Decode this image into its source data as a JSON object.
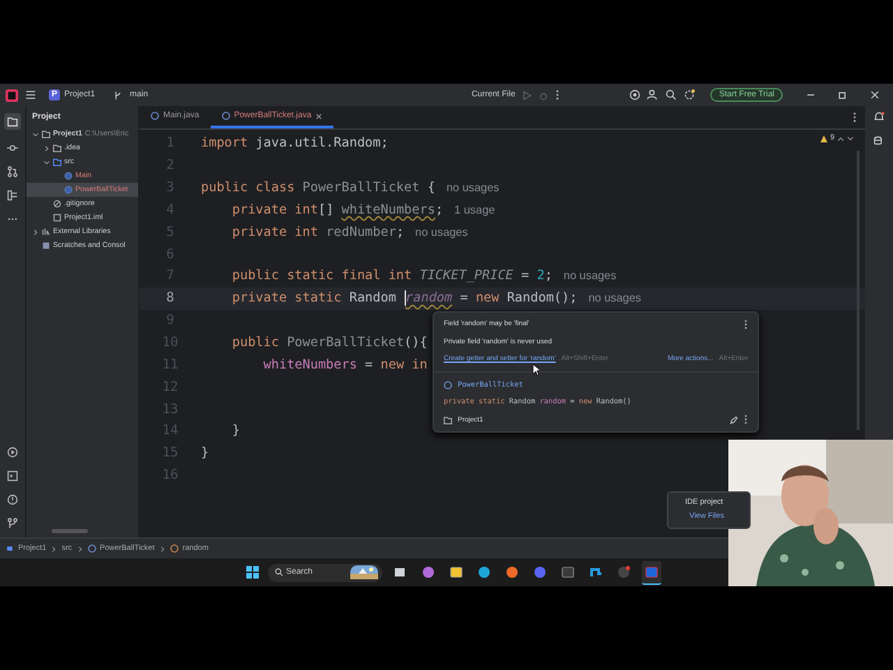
{
  "titlebar": {
    "project_badge": "P",
    "project": "Project1",
    "branch": "main",
    "run_config": "Current File",
    "trial_button": "Start Free Trial"
  },
  "project_panel": {
    "title": "Project",
    "tree": [
      {
        "kind": "module",
        "label": "Project1",
        "path": "C:\\Users\\Eric",
        "expanded": true,
        "selected": false,
        "children": [
          {
            "kind": "folder",
            "label": ".idea",
            "expanded": false,
            "selected": false
          },
          {
            "kind": "folder",
            "label": "src",
            "expanded": true,
            "selected": false,
            "children": [
              {
                "kind": "class",
                "label": "Main",
                "selected": false
              },
              {
                "kind": "class",
                "label": "PowerBallTicket",
                "selected": true
              }
            ]
          },
          {
            "kind": "ignore",
            "label": ".gitignore",
            "selected": false
          },
          {
            "kind": "file",
            "label": "Project1.iml",
            "selected": false
          }
        ]
      },
      {
        "kind": "library",
        "label": "External Libraries",
        "expanded": false,
        "selected": false
      },
      {
        "kind": "scratch",
        "label": "Scratches and Consol",
        "selected": false
      }
    ]
  },
  "tabs": [
    {
      "label": "Main.java",
      "selected": false
    },
    {
      "label": "PowerBallTicket.java",
      "selected": true
    }
  ],
  "problems_count": "9",
  "code_lines": [
    {
      "number": "1",
      "current": false,
      "tokens": [
        {
          "kind": "keyword",
          "text": "import "
        },
        {
          "kind": "plain",
          "text": "java.util.Random;"
        }
      ]
    },
    {
      "number": "2",
      "current": false
    },
    {
      "number": "3",
      "current": false,
      "tokens": [
        {
          "kind": "keyword",
          "text": "public class "
        },
        {
          "kind": "unused",
          "text": "PowerBallTicket "
        },
        {
          "kind": "plain",
          "text": "{"
        },
        {
          "kind": "hint",
          "text": "no usages"
        }
      ]
    },
    {
      "number": "4",
      "current": false,
      "tokens": [
        {
          "kind": "keyword",
          "text": "    private int"
        },
        {
          "kind": "plain",
          "text": "[] "
        },
        {
          "kind": "unused-warn",
          "text": "whiteNumbers"
        },
        {
          "kind": "plain",
          "text": ";"
        },
        {
          "kind": "hint",
          "text": "1 usage"
        }
      ]
    },
    {
      "number": "5",
      "current": false,
      "tokens": [
        {
          "kind": "keyword",
          "text": "    private int "
        },
        {
          "kind": "unused",
          "text": "redNumber"
        },
        {
          "kind": "plain",
          "text": ";"
        },
        {
          "kind": "hint",
          "text": "no usages"
        }
      ]
    },
    {
      "number": "6",
      "current": false
    },
    {
      "number": "7",
      "current": false,
      "tokens": [
        {
          "kind": "keyword",
          "text": "    public static final int "
        },
        {
          "kind": "unused-static",
          "text": "TICKET_PRICE"
        },
        {
          "kind": "plain",
          "text": " = "
        },
        {
          "kind": "number",
          "text": "2"
        },
        {
          "kind": "plain",
          "text": ";"
        },
        {
          "kind": "hint",
          "text": "no usages"
        }
      ]
    },
    {
      "number": "8",
      "current": true,
      "tokens": [
        {
          "kind": "keyword",
          "text": "    private static "
        },
        {
          "kind": "plain",
          "text": "Random "
        },
        {
          "kind": "static-warn",
          "text": "random"
        },
        {
          "kind": "plain",
          "text": " = "
        },
        {
          "kind": "keyword",
          "text": "new "
        },
        {
          "kind": "plain",
          "text": "Random();"
        },
        {
          "kind": "hint",
          "text": "no usages"
        }
      ]
    },
    {
      "number": "9",
      "current": false
    },
    {
      "number": "10",
      "current": false,
      "tokens": [
        {
          "kind": "keyword",
          "text": "    public "
        },
        {
          "kind": "unused",
          "text": "PowerBallTicket"
        },
        {
          "kind": "plain",
          "text": "(){"
        }
      ]
    },
    {
      "number": "11",
      "current": false,
      "tokens": [
        {
          "kind": "field",
          "text": "        whiteNumbers"
        },
        {
          "kind": "plain",
          "text": " = "
        },
        {
          "kind": "keyword",
          "text": "new "
        },
        {
          "kind": "keyword",
          "text": "in"
        }
      ]
    },
    {
      "number": "12",
      "current": false
    },
    {
      "number": "13",
      "current": false
    },
    {
      "number": "14",
      "current": false,
      "tokens": [
        {
          "kind": "plain",
          "text": "    }"
        }
      ]
    },
    {
      "number": "15",
      "current": false,
      "tokens": [
        {
          "kind": "plain",
          "text": "}"
        }
      ]
    },
    {
      "number": "16",
      "current": false
    }
  ],
  "popup": {
    "messages": [
      "Field 'random' may be 'final'",
      "Private field 'random' is never used"
    ],
    "action": "Create getter and setter for 'random'",
    "action_shortcut": "Alt+Shift+Enter",
    "more_actions": "More actions...",
    "more_shortcut": "Alt+Enter",
    "class_name": "PowerBallTicket",
    "declaration": [
      {
        "kind": "keyword",
        "text": "private static "
      },
      {
        "kind": "plain",
        "text": "Random "
      },
      {
        "kind": "field",
        "text": "random"
      },
      {
        "kind": "plain",
        "text": " = "
      },
      {
        "kind": "keyword",
        "text": "new "
      },
      {
        "kind": "plain",
        "text": "Random()"
      }
    ],
    "project": "Project1"
  },
  "notification": {
    "title": "IDE project",
    "link": "View Files"
  },
  "breadcrumbs": [
    {
      "kind": "module",
      "label": "Project1"
    },
    {
      "kind": "folder",
      "label": "src"
    },
    {
      "kind": "class",
      "label": "PowerBallTicket"
    },
    {
      "kind": "field",
      "label": "random"
    }
  ],
  "taskbar": {
    "search": {
      "placeholder": "Search"
    },
    "apps": [
      {
        "kind": "taskview",
        "active": false
      },
      {
        "kind": "copilot",
        "active": false
      },
      {
        "kind": "folder",
        "active": false
      },
      {
        "kind": "edge",
        "active": false
      },
      {
        "kind": "firefox",
        "active": false
      },
      {
        "kind": "chat",
        "active": false
      },
      {
        "kind": "terminal",
        "active": false
      },
      {
        "kind": "ps",
        "active": false
      },
      {
        "kind": "obs",
        "active": false
      },
      {
        "kind": "ide",
        "active": true
      }
    ]
  }
}
